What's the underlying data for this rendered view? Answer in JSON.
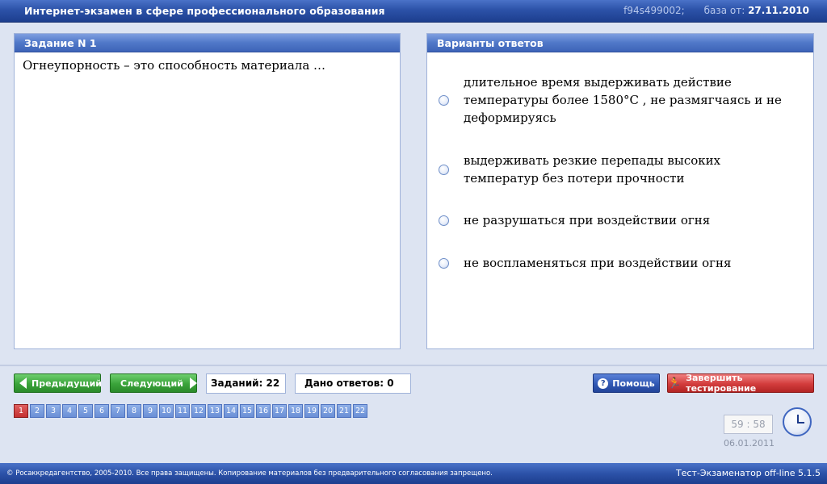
{
  "header": {
    "title": "Интернет-экзамен в сфере профессионального образования",
    "test_id": "f94s499002;",
    "base_label": "база от:",
    "base_date": "27.11.2010"
  },
  "question_panel": {
    "heading": "Задание N 1",
    "text": "Огнеупорность – это способность материала …"
  },
  "answers_panel": {
    "heading": "Варианты ответов",
    "options": [
      "длительное время выдерживать действие температуры более 1580°С , не размягчаясь и не деформируясь",
      "выдерживать резкие перепады высоких температур без потери прочности",
      "не разрушаться при воздействии огня",
      "не воспламеняться при воздействии огня"
    ]
  },
  "nav": {
    "prev_label": "Предыдущий",
    "next_label": "Следующий",
    "tasks_count": "Заданий: 22",
    "answers_given": "Дано ответов: 0",
    "help_label": "Помощь",
    "finish_label": "Завершить тестирование"
  },
  "question_numbers": [
    "1",
    "2",
    "3",
    "4",
    "5",
    "6",
    "7",
    "8",
    "9",
    "10",
    "11",
    "12",
    "13",
    "14",
    "15",
    "16",
    "17",
    "18",
    "19",
    "20",
    "21",
    "22"
  ],
  "current_question": 1,
  "timer": {
    "time": "59 : 58",
    "date": "06.01.2011"
  },
  "footer": {
    "copyright": "© Росаккредагентство, 2005-2010. Все права защищены. Копирование материалов без предварительного согласования запрещено.",
    "version": "Тест-Экзаменатор off-line 5.1.5"
  },
  "colors": {
    "accent": "#2c52a8",
    "current_question": "#c43030",
    "nav_green": "#3aa33a",
    "finish_red": "#d23c3c"
  },
  "icons": [
    "arrow-left-icon",
    "arrow-right-icon",
    "help-icon",
    "runner-icon",
    "clock-icon"
  ]
}
